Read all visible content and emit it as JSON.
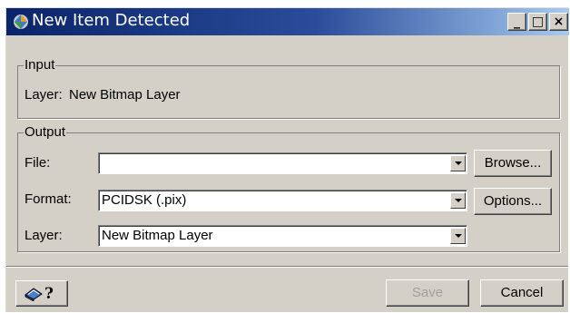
{
  "window": {
    "title": "New Item Detected",
    "app_icon": "pci-geomatica-icon",
    "controls": {
      "minimize": "_",
      "maximize": "□",
      "close": "×"
    }
  },
  "input_group": {
    "legend": "Input",
    "layer_label": "Layer:",
    "layer_value": "New Bitmap Layer"
  },
  "output_group": {
    "legend": "Output",
    "file": {
      "label": "File:",
      "value": ""
    },
    "format": {
      "label": "Format:",
      "value": "PCIDSK (.pix)"
    },
    "layer": {
      "label": "Layer:",
      "value": "New Bitmap Layer"
    },
    "browse_label": "Browse...",
    "options_label": "Options..."
  },
  "footer": {
    "help_icon": "help-icon",
    "help_label": "?",
    "save_label": "Save",
    "save_enabled": false,
    "cancel_label": "Cancel"
  }
}
